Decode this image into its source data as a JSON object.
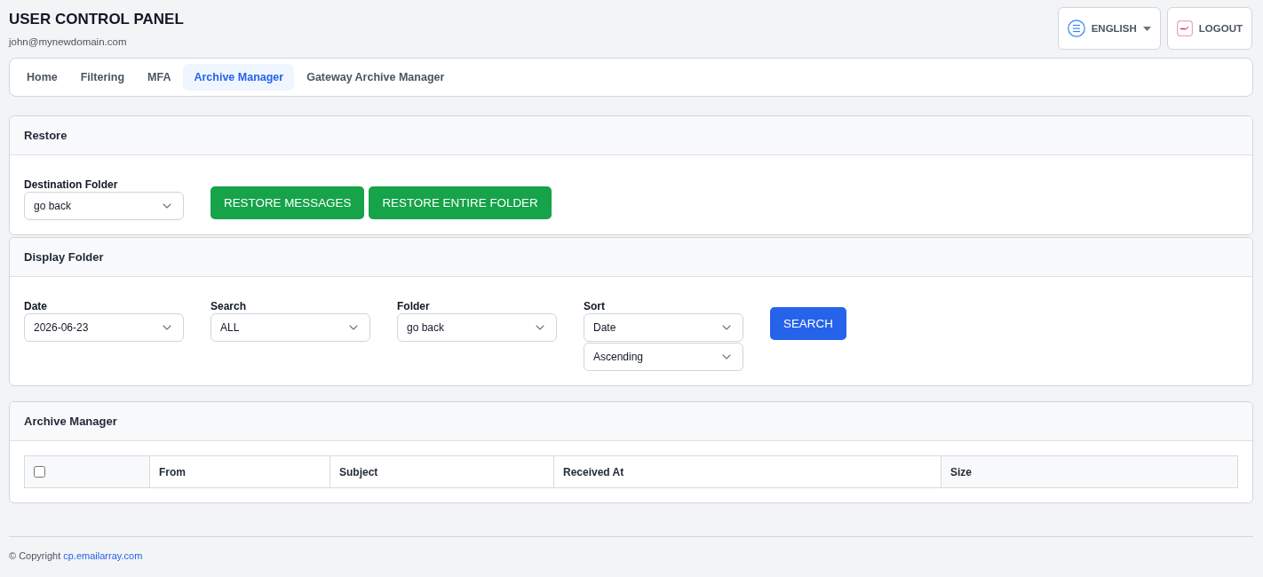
{
  "header": {
    "title": "USER CONTROL PANEL",
    "email": "john@mynewdomain.com",
    "language_button": {
      "label": "ENGLISH"
    },
    "logout_button": {
      "label": "LOGOUT"
    }
  },
  "tabs": [
    {
      "label": "Home",
      "selected": false
    },
    {
      "label": "Filtering",
      "selected": false
    },
    {
      "label": "MFA",
      "selected": false
    },
    {
      "label": "Archive Manager",
      "selected": true
    },
    {
      "label": "Gateway Archive Manager",
      "selected": false
    }
  ],
  "restore": {
    "title": "Restore",
    "destination_folder": {
      "label": "Destination Folder",
      "value": "go back"
    },
    "buttons": [
      "RESTORE MESSAGES",
      "RESTORE ENTIRE FOLDER"
    ]
  },
  "display_folder": {
    "title": "Display Folder",
    "fields": [
      {
        "label": "Date",
        "values": [
          "2026-06-23"
        ]
      },
      {
        "label": "Search",
        "values": [
          "ALL"
        ]
      },
      {
        "label": "Folder",
        "values": [
          "go back"
        ]
      },
      {
        "label": "Sort",
        "values": [
          "Date",
          "Ascending"
        ]
      }
    ],
    "search_button": {
      "label": "SEARCH"
    }
  },
  "archive_manager": {
    "title": "Archive Manager",
    "table": {
      "select_all": {
        "checked": false
      },
      "columns": [
        "From",
        "Subject",
        "Received At",
        "Size"
      ]
    }
  },
  "footer": {
    "copyright": "© Copyright",
    "link": "cp.emailarray.com"
  }
}
